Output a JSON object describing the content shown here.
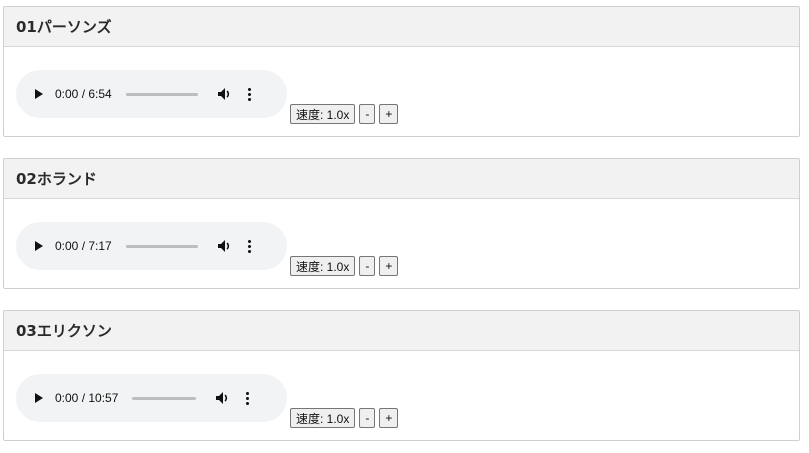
{
  "tracks": [
    {
      "title": "01パーソンズ",
      "time": "0:00 / 6:54",
      "speed_label": "速度: 1.0x",
      "minus_label": "-",
      "plus_label": "+"
    },
    {
      "title": "02ホランド",
      "time": "0:00 / 7:17",
      "speed_label": "速度: 1.0x",
      "minus_label": "-",
      "plus_label": "+"
    },
    {
      "title": "03エリクソン",
      "time": "0:00 / 10:57",
      "speed_label": "速度: 1.0x",
      "minus_label": "-",
      "plus_label": "+"
    }
  ],
  "icons": {
    "play": "play-icon",
    "volume": "volume-icon",
    "more": "more-vertical-icon"
  }
}
